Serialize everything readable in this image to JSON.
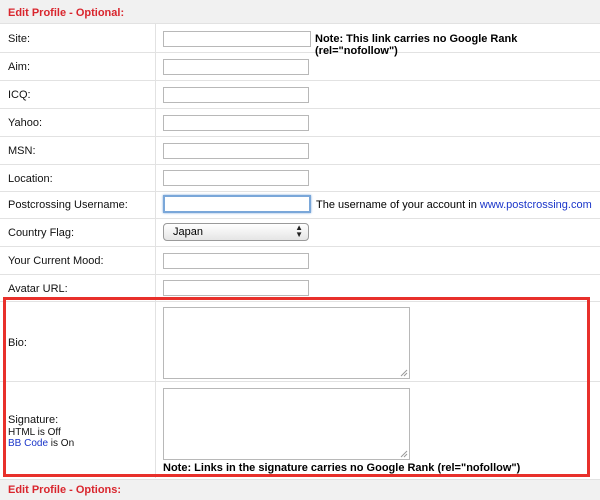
{
  "section_title": "Edit Profile - Optional:",
  "fields": {
    "site": {
      "label": "Site:",
      "value": "",
      "note": "Note: This link carries no Google Rank (rel=\"nofollow\")"
    },
    "aim": {
      "label": "Aim:",
      "value": ""
    },
    "icq": {
      "label": "ICQ:",
      "value": ""
    },
    "yahoo": {
      "label": "Yahoo:",
      "value": ""
    },
    "msn": {
      "label": "MSN:",
      "value": ""
    },
    "location": {
      "label": "Location:",
      "value": ""
    },
    "postcrossing": {
      "label": "Postcrossing Username:",
      "value": "",
      "note_prefix": "The username of your account in ",
      "note_link": "www.postcrossing.com"
    },
    "country_flag": {
      "label": "Country Flag:",
      "selected": "Japan"
    },
    "mood": {
      "label": "Your Current Mood:",
      "value": ""
    },
    "avatar": {
      "label": "Avatar URL:",
      "value": ""
    },
    "bio": {
      "label": "Bio:",
      "value": ""
    },
    "signature": {
      "label": "Signature:",
      "html_status": "HTML is Off",
      "bbcode_link": "BB Code",
      "bbcode_status": " is On",
      "value": "",
      "note": "Note: Links in the signature carries no Google Rank (rel=\"nofollow\")"
    }
  },
  "next_section_title": "Edit Profile - Options:",
  "colors": {
    "header_text": "#d9262e",
    "highlight": "#e8302b",
    "link": "#1a35c9"
  }
}
